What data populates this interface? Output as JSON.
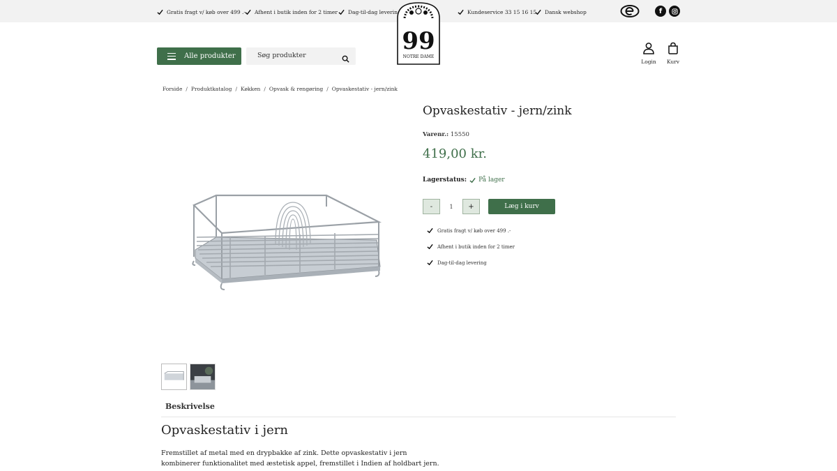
{
  "topbar": {
    "usps": [
      {
        "label": "Gratis fragt v/ køb over 499 .-"
      },
      {
        "label": "Afhent i butik inden for 2 timer"
      },
      {
        "label": "Dag-til-dag levering"
      },
      {
        "label": "Kundeservice 33 15 16 15"
      },
      {
        "label": "Dansk webshop"
      }
    ],
    "social": {
      "facebook": "f"
    }
  },
  "logo": {
    "text": "NOTRE DAME",
    "number": "99"
  },
  "header": {
    "all_products_label": "Alle produkter",
    "search_placeholder": "Søg produkter",
    "login_label": "Login",
    "cart_label": "Kurv"
  },
  "breadcrumb": [
    "Forside",
    "Produktkatalog",
    "Køkken",
    "Opvask & rengøring",
    "Opvaskestativ - jern/zink"
  ],
  "product": {
    "title": "Opvaskestativ - jern/zink",
    "sku_label": "Varenr.:",
    "sku": "15550",
    "price": "419,00 kr.",
    "stock_label": "Lagerstatus:",
    "stock_value": "På lager",
    "qty_minus": "-",
    "qty_value": "1",
    "qty_plus": "+",
    "add_to_cart": "Læg i kurv",
    "benefits": [
      "Gratis fragt v/ køb over 499 .-",
      "Afhent i butik inden for 2 timer",
      "Dag-til-dag levering"
    ]
  },
  "description": {
    "tab_label": "Beskrivelse",
    "heading": "Opvaskestativ i jern",
    "text": "Fremstillet af metal med en drypbakke af zink. Dette opvaskestativ i jern kombinerer funktionalitet med æstetisk appel, fremstillet i Indien af holdbart jern."
  },
  "colors": {
    "brand_green": "#3f6f4a",
    "topbar_bg": "#f2f2f2"
  }
}
